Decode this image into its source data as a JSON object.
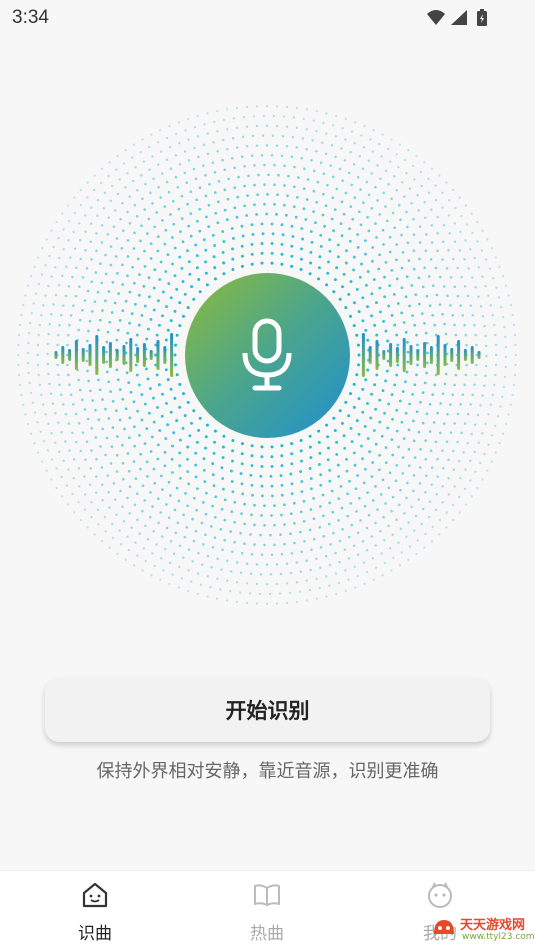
{
  "status_bar": {
    "time": "3:34",
    "icons": [
      "wifi-icon",
      "signal-icon",
      "battery-icon"
    ]
  },
  "recognizer": {
    "mic_icon": "microphone-icon",
    "accent_colors": [
      "#8dbb3a",
      "#4aa58e",
      "#1f8fd0"
    ],
    "dot_color": "#1db8d0",
    "start_label": "开始识别",
    "hint": "保持外界相对安静，靠近音源，识别更准确"
  },
  "tabs": [
    {
      "label": "识曲",
      "icon": "home-smile-icon",
      "active": true
    },
    {
      "label": "热曲",
      "icon": "book-icon",
      "active": false
    },
    {
      "label": "我的",
      "icon": "face-icon",
      "active": false
    }
  ],
  "watermark": {
    "text": "天天游戏网",
    "url": "www.ttyl23.com"
  }
}
